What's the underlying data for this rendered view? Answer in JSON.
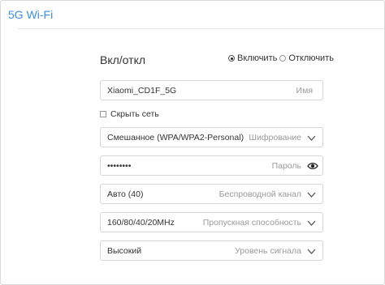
{
  "header": {
    "title": "5G Wi-Fi"
  },
  "toggle": {
    "label": "Вкл/откл",
    "options": [
      {
        "label": "Включить",
        "selected": true
      },
      {
        "label": "Отключить",
        "selected": false
      }
    ]
  },
  "ssid": {
    "value": "Xiaomi_CD1F_5G",
    "hint": "Имя"
  },
  "hide_network": {
    "label": "Скрыть сеть",
    "checked": false
  },
  "encryption": {
    "value": "Смешанное (WPA/WPA2-Personal)",
    "hint": "Шифрование"
  },
  "password": {
    "value": "••••••••",
    "hint": "Пароль"
  },
  "channel": {
    "value": "Авто (40)",
    "hint": "Беспроводной канал"
  },
  "bandwidth": {
    "value": "160/80/40/20MHz",
    "hint": "Пропускная способность"
  },
  "signal": {
    "value": "Высокий",
    "hint": "Уровень сигнала"
  },
  "colors": {
    "accent": "#3b8ee8",
    "border": "#d6d6d6",
    "hint": "#9a9a9a"
  }
}
